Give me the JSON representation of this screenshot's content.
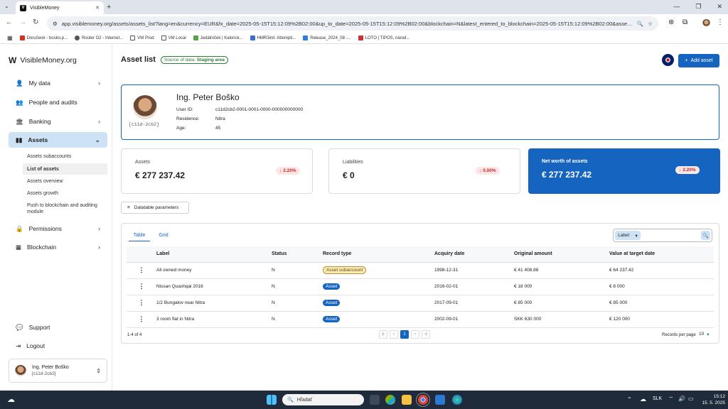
{
  "browser": {
    "tab_title": "VisibleMoney",
    "url": "app.visiblemoney.org/assets/assets_list?lang=en&currency=EUR&fx_date=2025-05-15T15:12:09%2B02:00&up_to_date=2025-05-15T15:12:09%2B02:00&blockchain=N&latest_entered_to_blockchain=2025-05-15T15:12:09%2B02:00&asset_type_...",
    "bookmarks": [
      "Doručené - bosko.p...",
      "Router O2 - Internet...",
      "VM Prod",
      "VM Local",
      "Jedálníček | Kalorick...",
      "HMR3init: Attempti...",
      "Release_2024_08 -...",
      "LOTO | TIPOS, národ..."
    ]
  },
  "sidebar": {
    "brand": "VisibleMoney.org",
    "nav": [
      {
        "label": "My data"
      },
      {
        "label": "People and audits"
      },
      {
        "label": "Banking"
      },
      {
        "label": "Assets"
      },
      {
        "label": "Permissions"
      },
      {
        "label": "Blockchain"
      }
    ],
    "subnav": [
      {
        "label": "Assets subaccounts"
      },
      {
        "label": "List of assets"
      },
      {
        "label": "Assets overview"
      },
      {
        "label": "Assets growth"
      },
      {
        "label": "Push to blockchain and auditing module"
      }
    ],
    "support": "Support",
    "logout": "Logout",
    "user_name": "Ing. Peter Boško",
    "user_code": "[c11d-2cb2]"
  },
  "header": {
    "title": "Asset list",
    "source_prefix": "Source of data:",
    "source_value": "Staging area",
    "add_button": "Add asset"
  },
  "profile": {
    "name": "Ing. Peter Boško",
    "code": "[c11d-2cb2]",
    "user_id_label": "User ID:",
    "user_id": "c11d2cb2-0001-0001-0000-000000000000",
    "residence_label": "Residence:",
    "residence": "Nitra",
    "age_label": "Age:",
    "age": "45"
  },
  "summary": {
    "assets_label": "Assets",
    "assets_value": "€ 277 237.42",
    "assets_change": "2.20%",
    "liabilities_label": "Liabilities",
    "liabilities_value": "€ 0",
    "liabilities_change": "0.00%",
    "networth_label": "Net worth of assets",
    "networth_value": "€ 277 237.42",
    "networth_change": "2.20%"
  },
  "params_button": "Datatable parameters",
  "view_tabs": [
    "Table",
    "Grid"
  ],
  "search": {
    "field_select": "Label"
  },
  "table": {
    "headers": [
      "Label",
      "Status",
      "Record type",
      "Acquiry date",
      "Original amount",
      "Value at target date"
    ],
    "rows": [
      {
        "label": "All owned money",
        "status": "N",
        "type": "Asset subaccount",
        "date": "1998-12-31",
        "orig": "€ 41 408.88",
        "value": "€ 64 237.42"
      },
      {
        "label": "Nissan Quashqai 2016",
        "status": "N",
        "type": "Asset",
        "date": "2016-02-01",
        "orig": "€ 18 000",
        "value": "€ 8 000"
      },
      {
        "label": "1/2 Bungalov near Nitra",
        "status": "N",
        "type": "Asset",
        "date": "2017-09-01",
        "orig": "€ 85 000",
        "value": "€ 85 000"
      },
      {
        "label": "3 room flat in Nitra",
        "status": "N",
        "type": "Asset",
        "date": "2002-09-01",
        "orig": "SKK 630 000",
        "value": "€ 120 000"
      }
    ],
    "range": "1-4 of 4",
    "page": "1",
    "records_label": "Records per page",
    "records_value": "10"
  },
  "taskbar": {
    "search_placeholder": "Hľadať",
    "lang": "SLK",
    "time": "15:12",
    "date": "15. 5. 2025"
  },
  "colors": {
    "primary": "#1565c0",
    "active_nav": "#cde3f5",
    "negative": "#c62828"
  }
}
